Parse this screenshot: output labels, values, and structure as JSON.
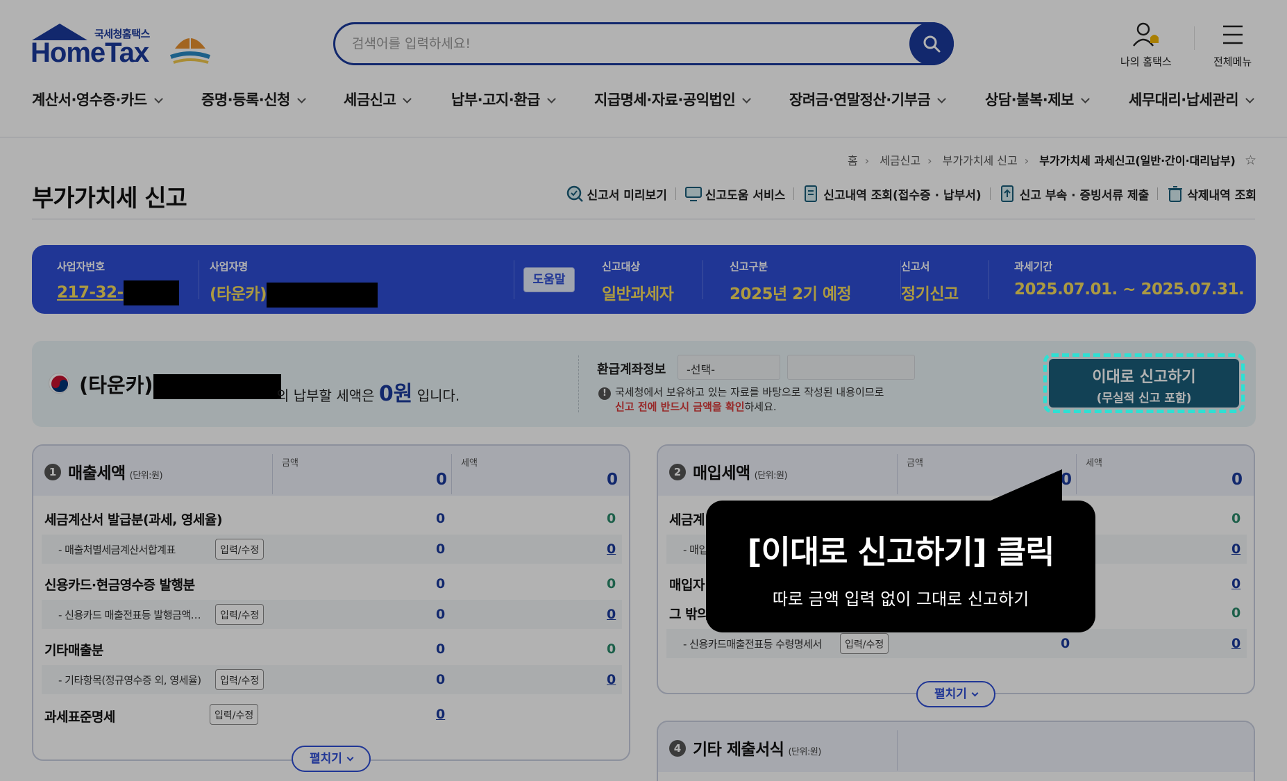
{
  "header": {
    "logo_small": "국세청홈택스",
    "logo_big": "HomeTax",
    "search_placeholder": "검색어를 입력하세요!",
    "my_hometax": "나의 홈택스",
    "all_menu": "전체메뉴"
  },
  "gnb": [
    "계산서·영수증·카드",
    "증명·등록·신청",
    "세금신고",
    "납부·고지·환급",
    "지급명세·자료·공익법인",
    "장려금·연말정산·기부금",
    "상담·불복·제보",
    "세무대리·납세관리"
  ],
  "breadcrumb": [
    "홈",
    "세금신고",
    "부가가치세 신고",
    "부가가치세 과세신고(일반·간이·대리납부)"
  ],
  "page_title": "부가가치세 신고",
  "quick_links": [
    "신고서 미리보기",
    "신고도움 서비스",
    "신고내역 조회(접수증 · 납부서)",
    "신고 부속 · 증빙서류 제출",
    "삭제내역 조회"
  ],
  "infobar": {
    "bizno_label": "사업자번호",
    "bizno_value": "217-32-",
    "bizname_label": "사업자명",
    "bizname_value": "(타운카)",
    "help": "도움말",
    "target_label": "신고대상",
    "target_value": "일반과세자",
    "type_label": "신고구분",
    "type_value": "2025년 2기 예정",
    "form_label": "신고서",
    "form_value": "정기신고",
    "period_label": "과세기간",
    "period_value": "2025.07.01. ~ 2025.07.31."
  },
  "summary": {
    "name": "(타운카)",
    "tail_pre": "의 납부할 세액은",
    "amount": "0원",
    "tail_post": "입니다.",
    "refund_label": "환급계좌정보",
    "refund_select": "-선택-",
    "notice_line1": "국세청에서 보유하고 있는 자료를 바탕으로 작성된 내용이므로",
    "notice_red": "신고 전에 반드시 금액을 확인",
    "notice_tail": "하세요.",
    "submit_line1": "이대로 신고하기",
    "submit_line2": "(무실적 신고 포함)"
  },
  "panel_sales": {
    "num": "1",
    "title": "매출세액",
    "unit": "(단위:원)",
    "col_amount": "금액",
    "col_tax": "세액",
    "head_amount": "0",
    "head_tax": "0",
    "rows": [
      {
        "label": "세금계산서 발급분(과세, 영세율)",
        "amount": "0",
        "tax": "0"
      },
      {
        "label": "- 매출처별세금계산서합계표",
        "edit": "입력/수정",
        "amount": "0",
        "tax": "0"
      },
      {
        "label": "신용카드·현금영수증 발행분",
        "amount": "0",
        "tax": "0"
      },
      {
        "label": "- 신용카드 매출전표등 발행금액…",
        "edit": "입력/수정",
        "amount": "0",
        "tax": "0"
      },
      {
        "label": "기타매출분",
        "amount": "0",
        "tax": "0"
      },
      {
        "label": "- 기타항목(정규영수증 외, 영세율)",
        "edit": "입력/수정",
        "amount": "0",
        "tax": "0"
      },
      {
        "label": "과세표준명세",
        "edit": "입력/수정",
        "amount": "0"
      }
    ],
    "expand": "펼치기"
  },
  "panel_purchase": {
    "num": "2",
    "title": "매입세액",
    "unit": "(단위:원)",
    "col_amount": "금액",
    "col_tax": "세액",
    "head_amount": "0",
    "head_tax": "0",
    "rows": [
      {
        "label": "세금계",
        "tax": "0"
      },
      {
        "label": "- 매입",
        "tax": "0"
      },
      {
        "label": "매입자",
        "tax": "0"
      },
      {
        "label": "그 밖의",
        "tax": "0"
      },
      {
        "label": "- 신용카드매출전표등 수령명세서",
        "edit": "입력/수정",
        "amount": "0",
        "tax": "0"
      }
    ],
    "expand": "펼치기"
  },
  "panel_other": {
    "num": "4",
    "title": "기타 제출서식",
    "unit": "(단위:원)"
  },
  "tooltip": {
    "title": "[이대로 신고하기] 클릭",
    "desc": "따로 금액 입력 없이 그대로 신고하기"
  },
  "colors": {
    "brand": "#1a3a9c",
    "infobar": "#2f4ed6",
    "highlight_yellow": "#f7dd5d",
    "submit": "#1a5e7a",
    "focus_ring": "#2fe0d3"
  }
}
